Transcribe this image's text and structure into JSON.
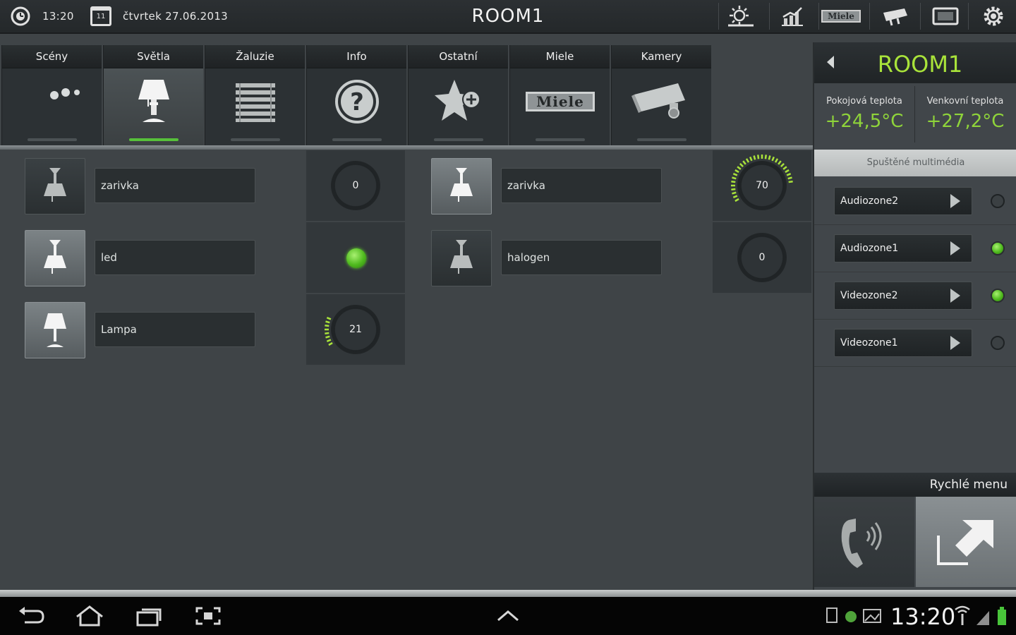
{
  "topbar": {
    "time": "13:20",
    "date": "čtvrtek 27.06.2013",
    "title": "ROOM1",
    "icons": [
      "clock-icon",
      "calendar-icon",
      "weather-icon",
      "chart-icon",
      "miele-icon",
      "camera-icon",
      "screen-icon",
      "gear-icon"
    ],
    "calendar_day": "11",
    "miele_mini": "Miele"
  },
  "tabs": [
    {
      "label": "Scény",
      "icon": "scenes-icon"
    },
    {
      "label": "Světla",
      "icon": "lamp-icon",
      "active": true
    },
    {
      "label": "Žaluzie",
      "icon": "blinds-icon"
    },
    {
      "label": "Info",
      "icon": "help-icon"
    },
    {
      "label": "Ostatní",
      "icon": "star-plus-icon"
    },
    {
      "label": "Miele",
      "icon": "miele-logo-icon",
      "logo_text": "Miele"
    },
    {
      "label": "Kamery",
      "icon": "camera-icon"
    }
  ],
  "lights": [
    {
      "name": "zarivka",
      "value": "0",
      "type": "dial",
      "lamp_on": false,
      "level": 0
    },
    {
      "name": "zarivka",
      "value": "70",
      "type": "dial",
      "lamp_on": true,
      "level": 70
    },
    {
      "name": "led",
      "value": "",
      "type": "led",
      "lamp_on": true,
      "level": 100
    },
    {
      "name": "halogen",
      "value": "0",
      "type": "dial",
      "lamp_on": false,
      "level": 0
    },
    {
      "name": "Lampa",
      "value": "21",
      "type": "dial",
      "lamp_on": true,
      "level": 21
    }
  ],
  "room_panel": {
    "title": "ROOM1",
    "indoor_label": "Pokojová teplota",
    "indoor_value": "+24,5°C",
    "outdoor_label": "Venkovní teplota",
    "outdoor_value": "+27,2°C",
    "multimedia_header": "Spuštěné multimédia",
    "multimedia": [
      {
        "name": "Audiozone2",
        "active": false
      },
      {
        "name": "Audiozone1",
        "active": true
      },
      {
        "name": "Videozone2",
        "active": true
      },
      {
        "name": "Videozone1",
        "active": false
      }
    ],
    "quick_menu_label": "Rychlé menu"
  },
  "navbar": {
    "time": "13:20"
  },
  "colors": {
    "accent_green": "#57c13a",
    "title_green": "#a9e33a",
    "temp_green": "#8fd43a"
  }
}
